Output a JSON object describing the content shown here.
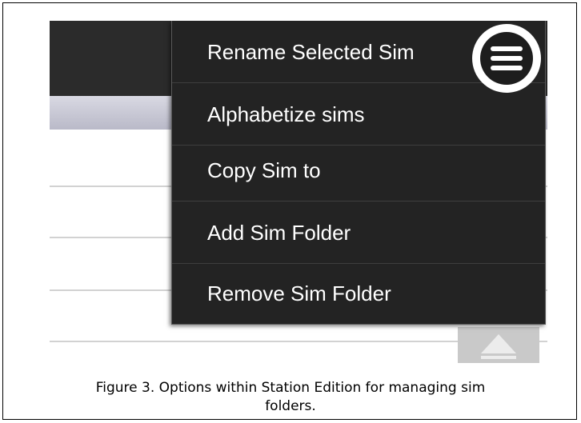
{
  "menu": {
    "items": [
      {
        "label": "Rename Selected Sim"
      },
      {
        "label": "Alphabetize sims"
      },
      {
        "label": "Copy Sim to"
      },
      {
        "label": "Add Sim Folder"
      },
      {
        "label": "Remove Sim Folder"
      }
    ],
    "button_icon": "hamburger-icon"
  },
  "caption": {
    "line1": "Figure 3. Options within Station Edition for managing sim",
    "line2": "folders."
  },
  "colors": {
    "header": "#2b2b2b",
    "menu_bg": "#232323",
    "sub_bar": "#c4c4d2"
  }
}
